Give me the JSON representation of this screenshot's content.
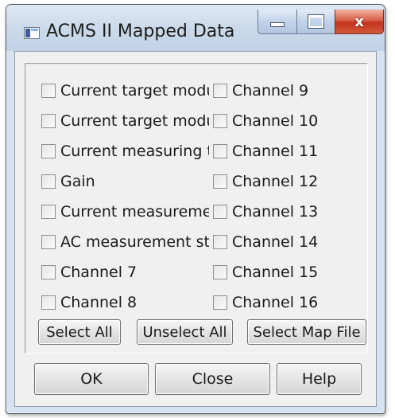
{
  "window": {
    "title": "ACMS II Mapped Data",
    "close_glyph": "x",
    "controls": [
      "minimize-icon",
      "maximize-icon",
      "close-icon"
    ]
  },
  "left_column": [
    {
      "label": "Current target modu",
      "checked": false
    },
    {
      "label": "Current target modu",
      "checked": false
    },
    {
      "label": "Current measuring ti",
      "checked": false
    },
    {
      "label": "Gain",
      "checked": false
    },
    {
      "label": "Current measuremei",
      "checked": false
    },
    {
      "label": "AC measurement st.",
      "checked": false
    },
    {
      "label": "Channel 7",
      "checked": false
    },
    {
      "label": "Channel 8",
      "checked": false
    }
  ],
  "right_column": [
    {
      "label": "Channel 9",
      "checked": false
    },
    {
      "label": "Channel 10",
      "checked": false
    },
    {
      "label": "Channel 11",
      "checked": false
    },
    {
      "label": "Channel 12",
      "checked": false
    },
    {
      "label": "Channel 13",
      "checked": false
    },
    {
      "label": "Channel 14",
      "checked": false
    },
    {
      "label": "Channel 15",
      "checked": false
    },
    {
      "label": "Channel 16",
      "checked": false
    }
  ],
  "actions": {
    "select_all": "Select All",
    "unselect_all": "Unselect All",
    "select_map_file": "Select Map File"
  },
  "footer": {
    "ok": "OK",
    "close": "Close",
    "help": "Help"
  }
}
